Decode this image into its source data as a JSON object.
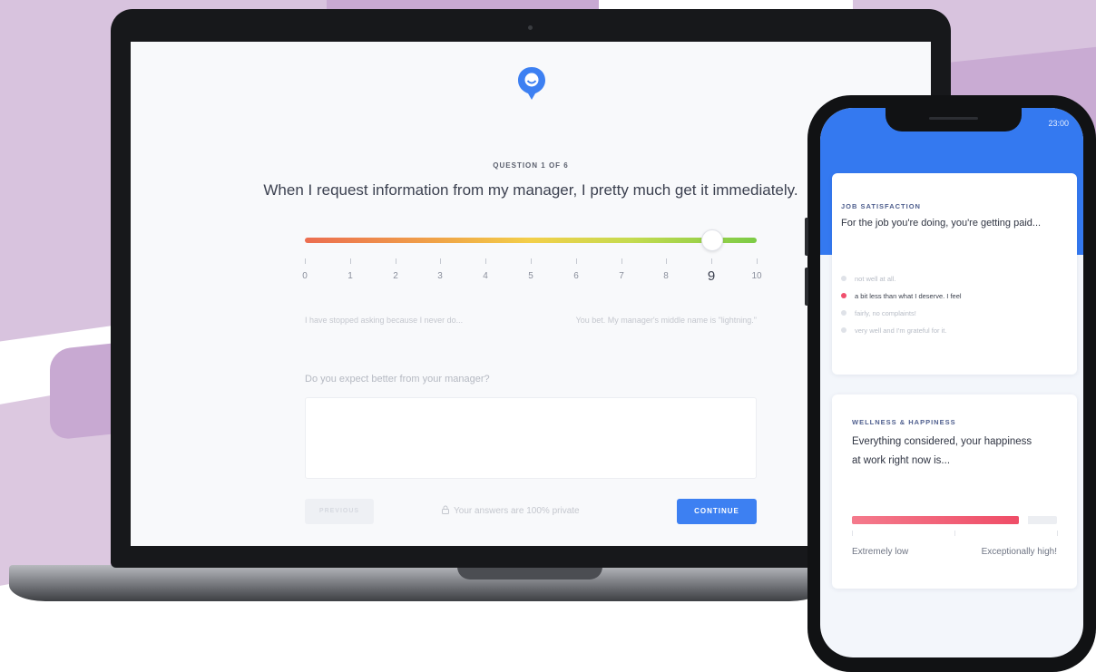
{
  "survey": {
    "question_counter": "QUESTION 1 OF 6",
    "question": "When I request information from my manager, I pretty much get it immediately.",
    "scale": {
      "min": 0,
      "max": 10,
      "selected": 9,
      "labels": [
        "0",
        "1",
        "2",
        "3",
        "4",
        "5",
        "6",
        "7",
        "8",
        "9",
        "10"
      ],
      "low_label": "I have stopped asking because I never do...",
      "high_label": "You bet. My manager's middle name is \"lightning.\""
    },
    "followup_question": "Do you expect better from your manager?",
    "followup_value": "",
    "previous_label": "PREVIOUS",
    "privacy_text": "Your answers are 100% private",
    "continue_label": "CONTINUE"
  },
  "phone": {
    "status_time": "23:00",
    "card1": {
      "category": "JOB SATISFACTION",
      "question": "For the job you're doing, you're getting paid...",
      "options": [
        "not well at all.",
        "a bit less than what I deserve. I feel",
        "fairly, no complaints!",
        "very well and I'm grateful for it."
      ],
      "selected_index": 1
    },
    "card2": {
      "category": "WELLNESS & HAPPINESS",
      "question": "Everything considered, your happiness at work right now is...",
      "level": 0.86,
      "low_label": "Extremely low",
      "high_label": "Exceptionally high!"
    }
  },
  "colors": {
    "accent": "#3d80f2",
    "phone_header": "#3479f0",
    "selected_option": "#f0506e",
    "background_purple": "#d8c3de"
  }
}
